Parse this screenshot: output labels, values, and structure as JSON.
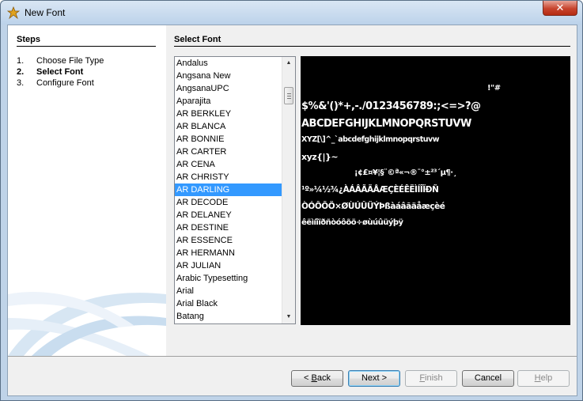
{
  "window": {
    "title": "New Font",
    "close_symbol": "✕"
  },
  "steps": {
    "title": "Steps",
    "items": [
      {
        "num": "1.",
        "label": "Choose File Type"
      },
      {
        "num": "2.",
        "label": "Select Font"
      },
      {
        "num": "3.",
        "label": "Configure Font"
      }
    ],
    "current_index": 1
  },
  "main": {
    "title": "Select Font",
    "fonts": [
      "Andalus",
      "Angsana New",
      "AngsanaUPC",
      "Aparajita",
      "AR BERKLEY",
      "AR BLANCA",
      "AR BONNIE",
      "AR CARTER",
      "AR CENA",
      "AR CHRISTY",
      "AR DARLING",
      "AR DECODE",
      "AR DELANEY",
      "AR DESTINE",
      "AR ESSENCE",
      "AR HERMANN",
      "AR JULIAN",
      "Arabic Typesetting",
      "Arial",
      "Arial Black",
      "Batang"
    ],
    "selected_font": "AR DARLING",
    "preview_lines": [
      "!\"#",
      "$%&'()*+,-./0123456789:;<=>?@",
      "ABCDEFGHIJKLMNOPQRSTUVW",
      "XYZ[\\]^_`abcdefghijklmnopqrstuvw",
      "xyz{|}~",
      "¡¢£¤¥¦§¨©ª«¬­®¯°±²³´µ¶·¸",
      "¹º»¼½¾¿ÀÁÂÃÄÅÆÇÈÉÊËÌÍÎÏÐÑ",
      "ÒÓÔÕÖ×ØÙÚÛÜÝÞßàáâãäåæçèé",
      "êëìíîïðñòóôõö÷øùúûüýþÿ"
    ]
  },
  "buttons": {
    "back": {
      "pre": "< ",
      "mnemonic": "B",
      "post": "ack"
    },
    "next": "Next >",
    "finish": {
      "mnemonic": "F",
      "post": "inish"
    },
    "cancel": "Cancel",
    "help": {
      "mnemonic": "H",
      "post": "elp"
    }
  },
  "icons": {
    "window": "wand-icon",
    "scroll_up": "▲",
    "scroll_down": "▼"
  },
  "colors": {
    "selection": "#3399ff",
    "preview_bg": "#000000",
    "close_button": "#c7442e"
  }
}
